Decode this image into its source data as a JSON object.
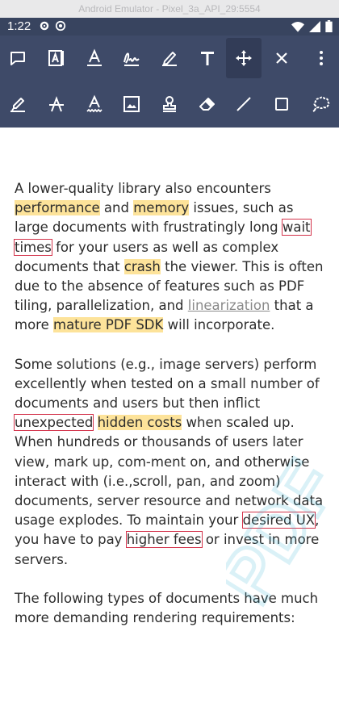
{
  "window": {
    "title": "Android Emulator - Pixel_3a_API_29:5554"
  },
  "status": {
    "time": "1:22",
    "left_icons": [
      "gear-icon",
      "at-icon"
    ],
    "right_icons": [
      "wifi-icon",
      "signal-icon",
      "battery-icon"
    ]
  },
  "toolbar": {
    "row1": [
      "comment-icon",
      "freetext-icon",
      "text-underline-icon",
      "signature-icon",
      "pen-icon",
      "text-icon",
      "move-icon",
      "close-icon",
      "more-vert-icon"
    ],
    "row2": [
      "highlighter-icon",
      "strikeout-icon",
      "squiggly-icon",
      "image-icon",
      "stamp-icon",
      "eraser-icon",
      "line-icon",
      "square-icon",
      "cloud-icon"
    ],
    "active_tool": "move-icon"
  },
  "document": {
    "p1": [
      {
        "t": "A lower-quality library also encounters "
      },
      {
        "t": "performance",
        "s": "hl"
      },
      {
        "t": " and "
      },
      {
        "t": "memory",
        "s": "hl"
      },
      {
        "t": " issues, such as large documents with frustratingly long "
      },
      {
        "t": "wait times",
        "s": "box"
      },
      {
        "t": " for your users as well as complex documents that "
      },
      {
        "t": "crash",
        "s": "hl"
      },
      {
        "t": " the viewer. This is often due to the absence of features such as PDF tiling, parallelization, and "
      },
      {
        "t": "linearization",
        "s": "link"
      },
      {
        "t": " that a more "
      },
      {
        "t": "mature PDF SDK",
        "s": "hl"
      },
      {
        "t": " will incorporate."
      }
    ],
    "p2": [
      {
        "t": "Some solutions (e.g., image servers) perform excellently when tested on a small number of documents and users but then inflict "
      },
      {
        "t": "unexpected",
        "s": "box"
      },
      {
        "t": " "
      },
      {
        "t": "hidden costs",
        "s": "hl"
      },
      {
        "t": " when scaled up. When hundreds or thousands of users later view, mark up, com-ment on, and otherwise interact with (i.e.,scroll, pan, and zoom) documents, server resource and network data usage explodes. To maintain your "
      },
      {
        "t": "desired UX",
        "s": "box"
      },
      {
        "t": ", you have to pay "
      },
      {
        "t": "higher fees",
        "s": "box"
      },
      {
        "t": " or invest in more servers."
      }
    ],
    "p3": [
      {
        "t": "The following types of documents have much more demanding rendering requirements:"
      }
    ]
  },
  "colors": {
    "toolbar": "#3e4a68",
    "status_bar": "#38445f",
    "highlight": "#fde39a",
    "box": "#d3334b",
    "link": "#8a8a8a"
  }
}
